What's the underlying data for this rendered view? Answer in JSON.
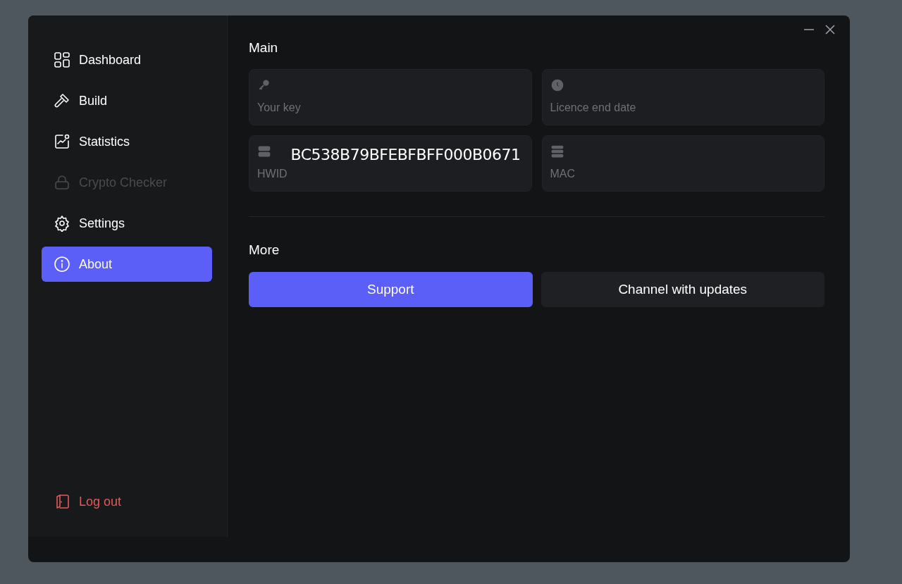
{
  "sidebar": {
    "items": [
      {
        "label": "Dashboard",
        "selected": false,
        "disabled": false
      },
      {
        "label": "Build",
        "selected": false,
        "disabled": false
      },
      {
        "label": "Statistics",
        "selected": false,
        "disabled": false
      },
      {
        "label": "Crypto Checker",
        "selected": false,
        "disabled": true
      },
      {
        "label": "Settings",
        "selected": false,
        "disabled": false
      },
      {
        "label": "About",
        "selected": true,
        "disabled": false
      }
    ],
    "logout": "Log out"
  },
  "main": {
    "title": "Main",
    "fields": [
      {
        "label": "Your key"
      },
      {
        "label": "Licence end date"
      },
      {
        "label": "HWID",
        "value": "BC538B79BFEBFBFF000B0671"
      },
      {
        "label": "MAC"
      }
    ]
  },
  "more": {
    "title": "More",
    "buttons": [
      {
        "label": "Support",
        "primary": true
      },
      {
        "label": "Channel with updates",
        "primary": false
      }
    ]
  }
}
